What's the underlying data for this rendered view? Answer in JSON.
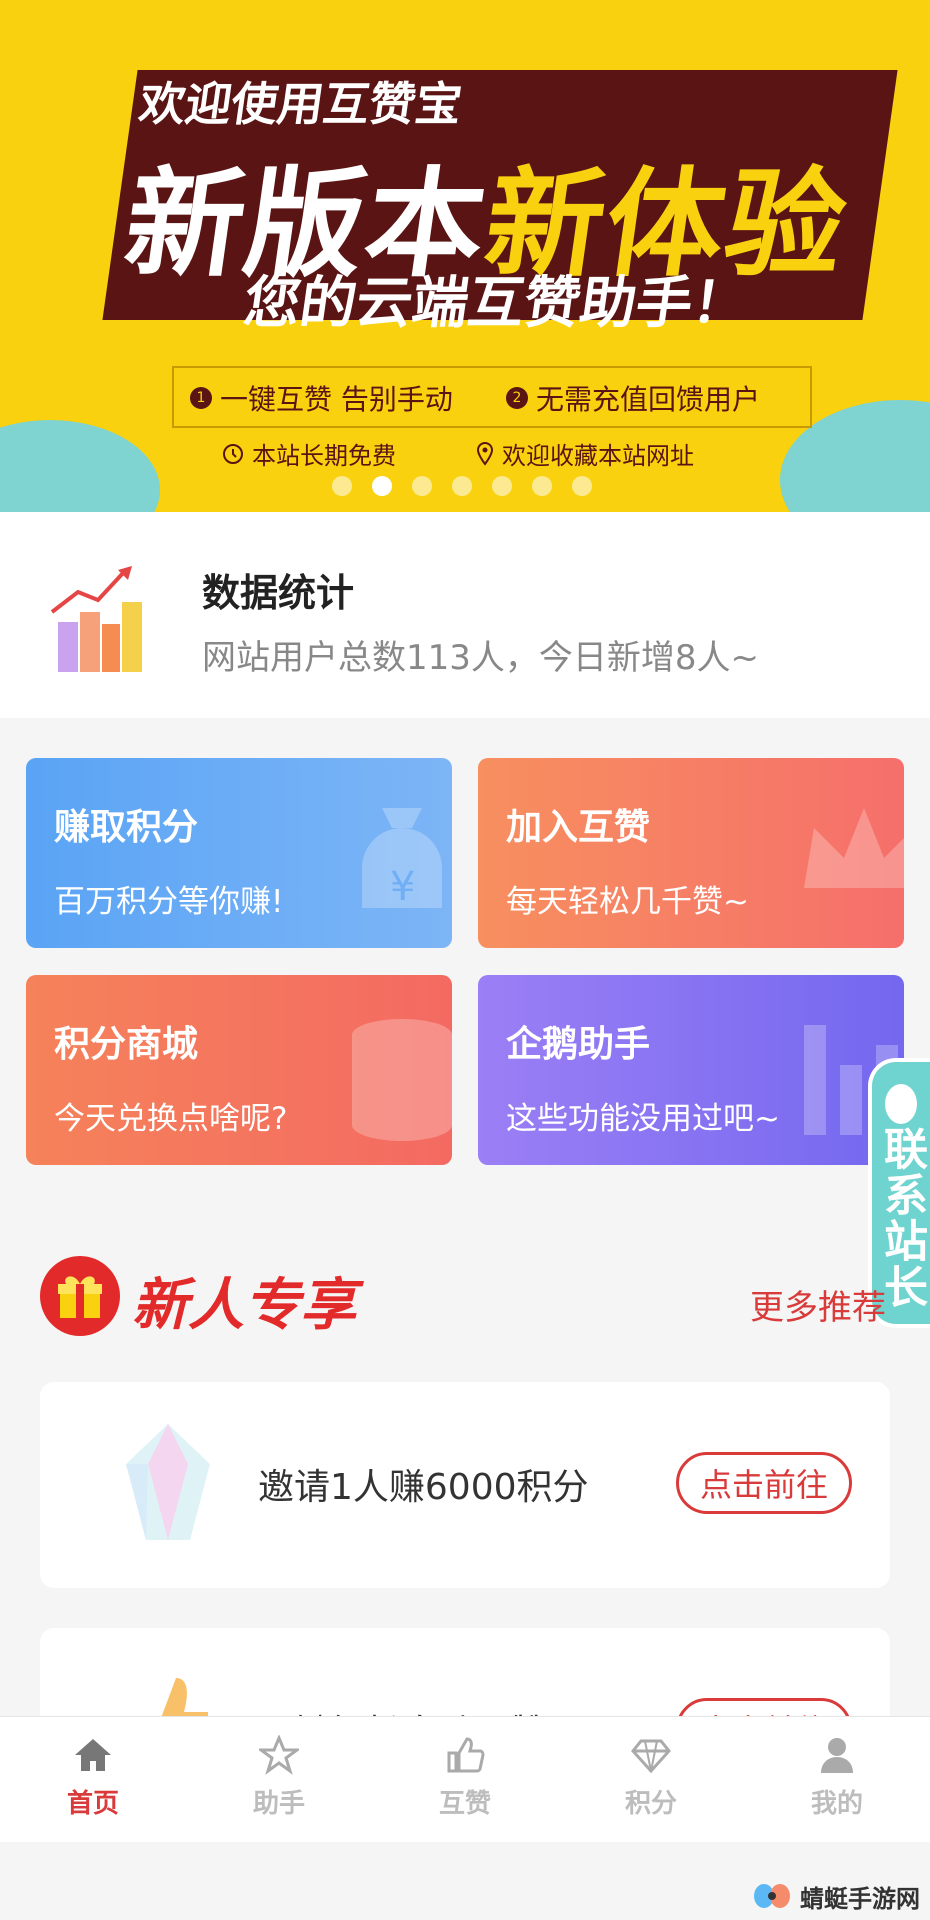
{
  "banner": {
    "line1": "欢迎使用互赞宝",
    "line2_a": "新版本",
    "line2_b": "新体验",
    "line3": "您的云端互赞助手！",
    "feature1": "一键互赞 告别手动",
    "feature2": "无需充值回馈用户",
    "feature3": "本站长期免费",
    "feature4": "欢迎收藏本站网址",
    "feature1_num": "1",
    "feature2_num": "2",
    "slide_count": 7,
    "active_slide": 2
  },
  "stats": {
    "title": "数据统计",
    "desc": "网站用户总数113人，今日新增8人~"
  },
  "cards": [
    {
      "title": "赚取积分",
      "desc": "百万积分等你赚!"
    },
    {
      "title": "加入互赞",
      "desc": "每天轻松几千赞~"
    },
    {
      "title": "积分商城",
      "desc": "今天兑换点啥呢?"
    },
    {
      "title": "企鹅助手",
      "desc": "这些功能没用过吧~"
    }
  ],
  "contact": {
    "label": "联系站长"
  },
  "section": {
    "title": "新人专享",
    "more": "更多推荐"
  },
  "items": [
    {
      "label": "邀请1人赚6000积分",
      "button": "点击前往"
    },
    {
      "label": "一键轻松自动互赞",
      "button": "点击前往"
    }
  ],
  "tabs": [
    {
      "label": "首页",
      "icon": "home-icon",
      "active": true
    },
    {
      "label": "助手",
      "icon": "star-icon",
      "active": false
    },
    {
      "label": "互赞",
      "icon": "thumbs-up-icon",
      "active": false
    },
    {
      "label": "积分",
      "icon": "diamond-icon",
      "active": false
    },
    {
      "label": "我的",
      "icon": "user-icon",
      "active": false
    }
  ],
  "watermark": {
    "name": "蜻蜓手游网"
  },
  "colors": {
    "accent": "#d93a3a",
    "banner_bg": "#f9d10f",
    "contact_bg": "#6fd3cf"
  }
}
